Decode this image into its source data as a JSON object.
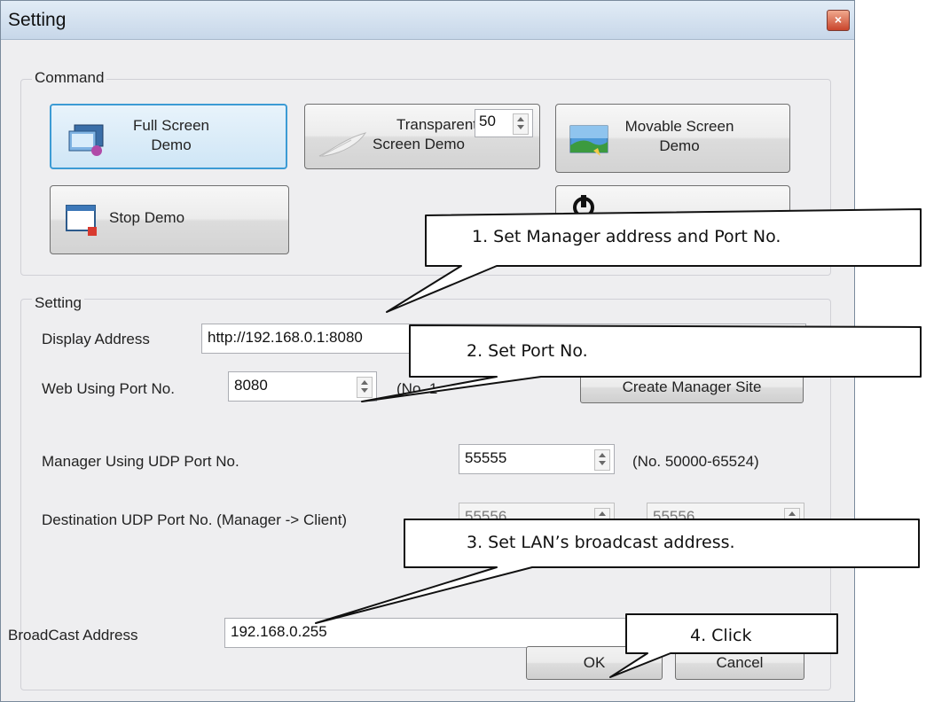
{
  "window": {
    "title": "Setting",
    "close_glyph": "×"
  },
  "command_group": {
    "label": "Command",
    "full_screen": {
      "line1": "Full Screen",
      "line2": "Demo",
      "icon": "monitor-icon"
    },
    "transparent": {
      "line1": "Transparent",
      "line2": "Screen Demo",
      "value": "50",
      "icon": "feather-icon"
    },
    "movable": {
      "line1": "Movable Screen",
      "line2": "Demo",
      "icon": "landscape-icon"
    },
    "stop": {
      "label": "Stop Demo",
      "icon": "window-stop-icon"
    },
    "power": {
      "icon": "power-icon"
    }
  },
  "setting_group": {
    "label": "Setting",
    "display_address": {
      "label": "Display Address",
      "value": "http://192.168.0.1:8080"
    },
    "web_port": {
      "label": "Web Using Port No.",
      "value": "8080",
      "range_visible": "(No. 1"
    },
    "create_site_button": "Create Manager Site",
    "manager_udp": {
      "label": "Manager Using UDP Port No.",
      "value": "55555",
      "range": "(No. 50000-65524)"
    },
    "destination_udp": {
      "label": "Destination UDP Port No. (Manager -> Client)",
      "value1": "55556",
      "value2": "55556"
    },
    "broadcast": {
      "label": "BroadCast Address",
      "value": "192.168.0.255"
    }
  },
  "buttons": {
    "ok": "OK",
    "cancel": "Cancel"
  },
  "callouts": {
    "c1": "1.    Set Manager address and Port No.",
    "c2": "2.  Set Port No.",
    "c3": "3. Set LAN’s broadcast address.",
    "c4": "4. Click"
  },
  "colors": {
    "focus_border": "#3c9bd4",
    "title_bar": "#c7d7e9",
    "close_button": "#c9452c"
  }
}
